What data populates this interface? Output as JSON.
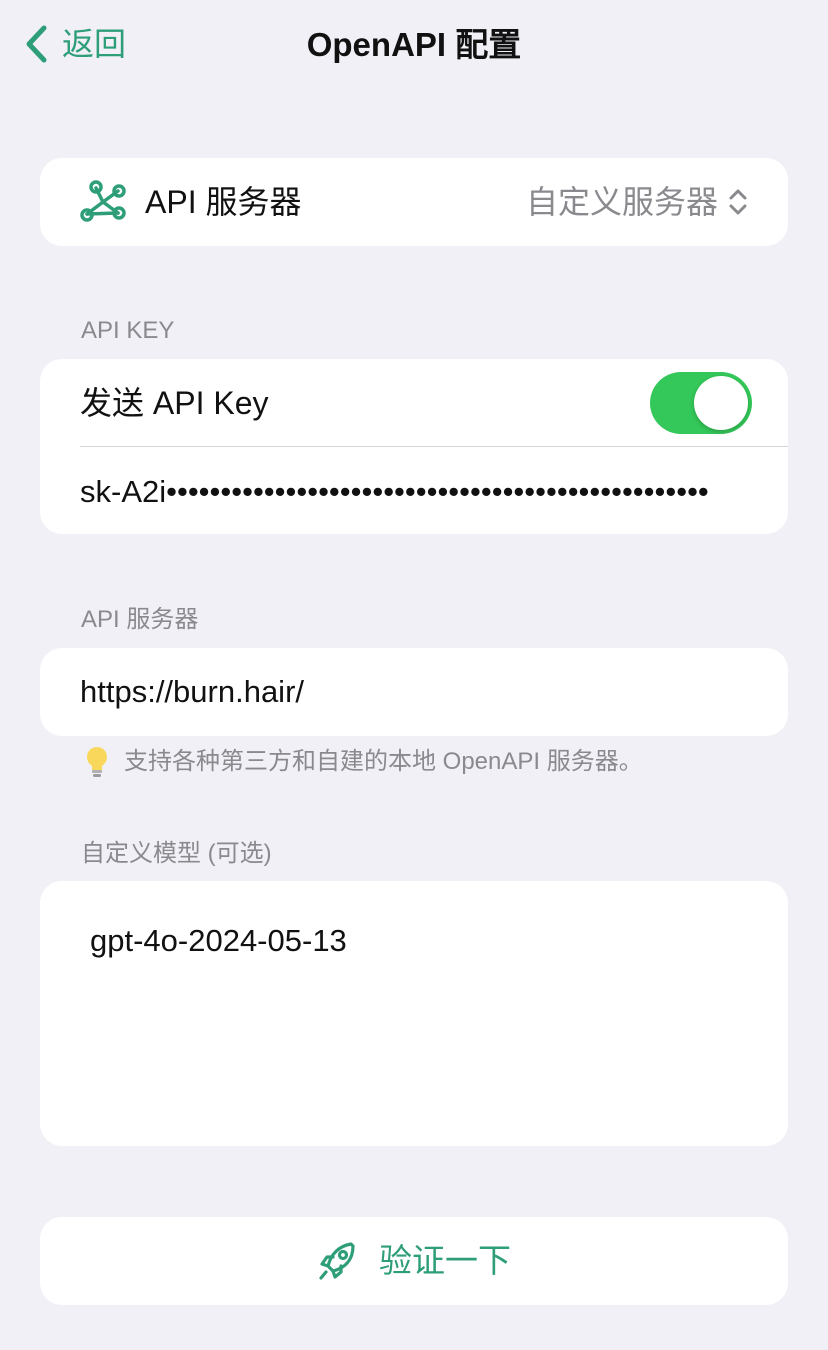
{
  "nav": {
    "back_label": "返回",
    "title": "OpenAPI 配置"
  },
  "server_row": {
    "icon": "network-nodes-icon",
    "label": "API 服务器",
    "value": "自定义服务器",
    "chevron_icon": "up-down-chevron-icon"
  },
  "api_key_section": {
    "header": "API KEY",
    "toggle_label": "发送 API Key",
    "toggle_on": true,
    "key_value": "sk-A2i••••••••••••••••••••••••••••••••••••••••••••••••••"
  },
  "server_section": {
    "header": "API 服务器",
    "url": "https://burn.hair/",
    "tip_icon": "lightbulb-icon",
    "tip": "支持各种第三方和自建的本地 OpenAPI 服务器。"
  },
  "model_section": {
    "header": "自定义模型 (可选)",
    "model": "gpt-4o-2024-05-13"
  },
  "verify": {
    "icon": "rocket-icon",
    "label": "验证一下"
  },
  "colors": {
    "accent": "#2E9E79",
    "toggle_on": "#34C759",
    "background": "#F1F0F6",
    "secondary_text": "#8A8A8E"
  }
}
